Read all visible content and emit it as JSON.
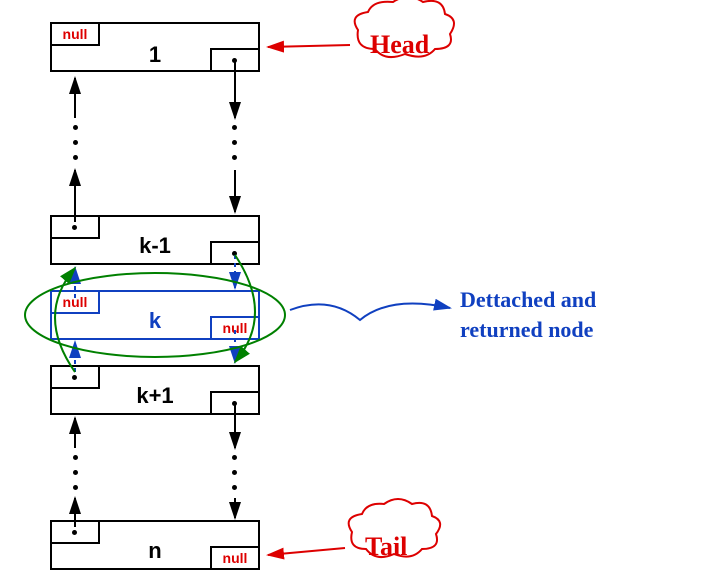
{
  "diagram": {
    "nodes": {
      "head": {
        "prev": "null",
        "label": "1",
        "next": ""
      },
      "km1": {
        "prev": "",
        "label": "k-1",
        "next": ""
      },
      "k": {
        "prev": "null",
        "label": "k",
        "next": "null"
      },
      "kp1": {
        "prev": "",
        "label": "k+1",
        "next": ""
      },
      "tail": {
        "prev": "",
        "label": "n",
        "next": "null"
      }
    },
    "callouts": {
      "head": "Head",
      "tail": "Tail",
      "detached_line1": "Dettached and",
      "detached_line2": "returned node"
    }
  }
}
